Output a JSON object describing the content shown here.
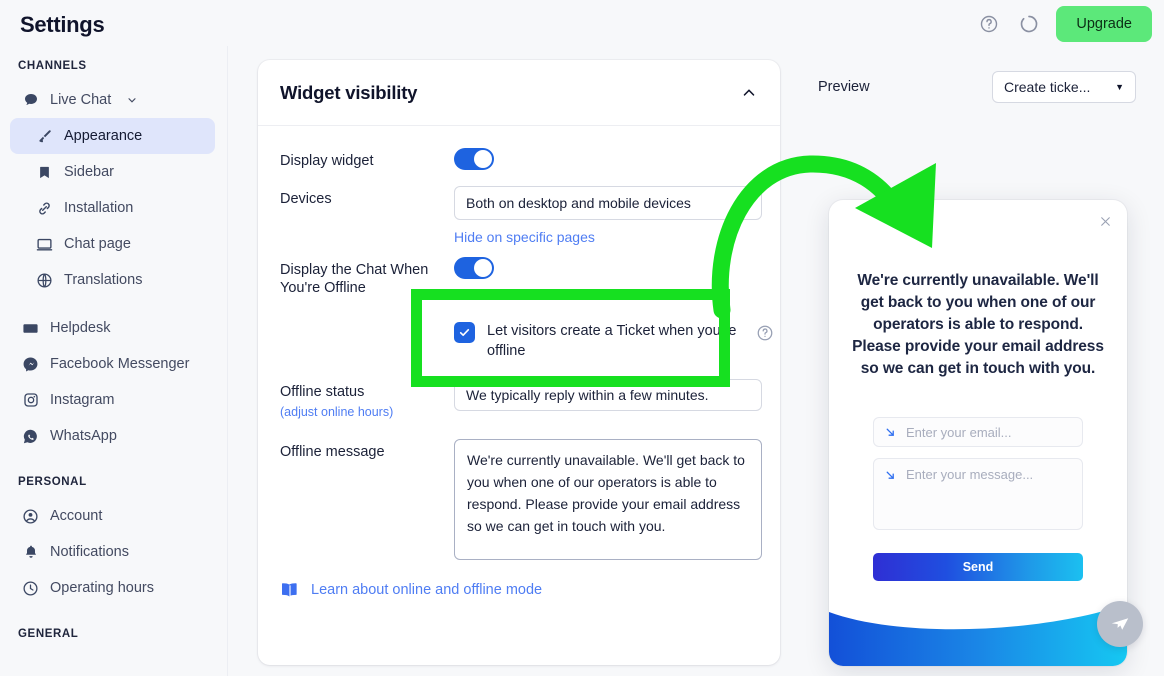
{
  "topbar": {
    "title": "Settings",
    "help_icon": "question-circle-icon",
    "loading_icon": "loading-spinner-icon",
    "upgrade_label": "Upgrade",
    "upgrade_color": "#5ce87a"
  },
  "sidebar": {
    "groups": [
      {
        "label": "CHANNELS",
        "items": [
          {
            "label": "Live Chat",
            "icon": "chat-bubble-icon",
            "expandable": true,
            "active": false,
            "sub": false
          },
          {
            "label": "Appearance",
            "icon": "paintbrush-icon",
            "active": true,
            "sub": true
          },
          {
            "label": "Sidebar",
            "icon": "bookmark-icon",
            "active": false,
            "sub": true
          },
          {
            "label": "Installation",
            "icon": "link-icon",
            "active": false,
            "sub": true
          },
          {
            "label": "Chat page",
            "icon": "monitor-icon",
            "active": false,
            "sub": true
          },
          {
            "label": "Translations",
            "icon": "globe-icon",
            "active": false,
            "sub": true
          },
          {
            "label": "Helpdesk",
            "icon": "envelope-icon",
            "active": false,
            "sub": false
          },
          {
            "label": "Facebook Messenger",
            "icon": "messenger-icon",
            "active": false,
            "sub": false
          },
          {
            "label": "Instagram",
            "icon": "instagram-icon",
            "active": false,
            "sub": false
          },
          {
            "label": "WhatsApp",
            "icon": "whatsapp-icon",
            "active": false,
            "sub": false
          }
        ]
      },
      {
        "label": "PERSONAL",
        "items": [
          {
            "label": "Account",
            "icon": "user-circle-icon",
            "active": false,
            "sub": false
          },
          {
            "label": "Notifications",
            "icon": "bell-icon",
            "active": false,
            "sub": false
          },
          {
            "label": "Operating hours",
            "icon": "clock-icon",
            "active": false,
            "sub": false
          }
        ]
      },
      {
        "label": "GENERAL",
        "items": []
      }
    ]
  },
  "card": {
    "title": "Widget visibility",
    "collapse_icon": "chevron-up-icon",
    "display_widget": {
      "label": "Display widget",
      "toggle_on": true,
      "accent": "#1e63e0"
    },
    "devices": {
      "label": "Devices",
      "value": "Both on desktop and mobile devices",
      "hide_link": "Hide on specific pages"
    },
    "offline_chat": {
      "label": "Display the Chat When You're Offline",
      "toggle_on": true
    },
    "ticket_checkbox": {
      "label": "Let visitors create a Ticket when you're offline",
      "checked": true,
      "help_icon": "question-circle-icon"
    },
    "offline_status": {
      "label": "Offline status",
      "sub_link": "(adjust online hours)",
      "value": "We typically reply within a few minutes."
    },
    "offline_message": {
      "label": "Offline message",
      "value": "We're currently unavailable. We'll get back to you when one of our operators is able to respond. Please provide your email address so we can get in touch with you."
    },
    "learn_link": {
      "label": "Learn about online and offline mode",
      "icon": "book-icon"
    }
  },
  "preview": {
    "label": "Preview",
    "mode_value": "Create ticke...",
    "caret_icon": "caret-down-icon",
    "widget": {
      "close_icon": "close-icon",
      "message": "We're currently unavailable. We'll get back to you when one of our operators is able to respond. Please provide your email address so we can get in touch with you.",
      "email_placeholder": "Enter your email...",
      "message_placeholder": "Enter your message...",
      "field_icon": "arrow-down-right-icon",
      "send_label": "Send",
      "send_gradient_from": "#2f2fd4",
      "send_gradient_to": "#1bc0f0",
      "launcher_icon": "paper-plane-icon"
    }
  },
  "annotation": {
    "highlight_color": "#16e020",
    "highlight_target": "ticket-checkbox",
    "arrow_icon": "curved-arrow-icon"
  }
}
